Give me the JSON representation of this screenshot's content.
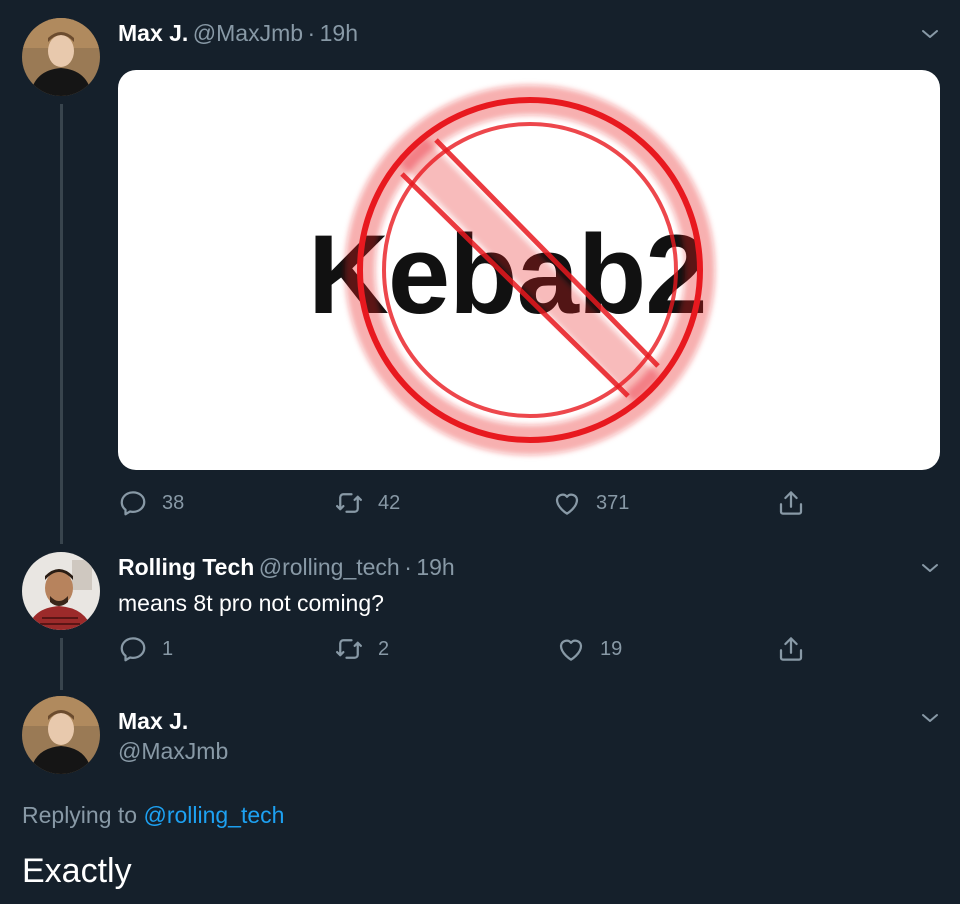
{
  "tweets": [
    {
      "name": "Max J.",
      "handle": "@MaxJmb",
      "separator": "·",
      "time": "19h",
      "media_text": "Kebab2",
      "replies": "38",
      "retweets": "42",
      "likes": "371"
    },
    {
      "name": "Rolling Tech",
      "handle": "@rolling_tech",
      "separator": "·",
      "time": "19h",
      "text": "means 8t pro not coming?",
      "replies": "1",
      "retweets": "2",
      "likes": "19"
    }
  ],
  "focused": {
    "name": "Max J.",
    "handle": "@MaxJmb",
    "replying_prefix": "Replying to",
    "replying_handle": "@rolling_tech",
    "text": "Exactly"
  },
  "colors": {
    "background": "#15202b",
    "secondary_text": "#8899a6",
    "link": "#1da1f2",
    "prohibition_red": "#e8191f"
  },
  "icons": [
    "reply-icon",
    "retweet-icon",
    "like-icon",
    "share-icon",
    "chevron-down-icon",
    "prohibition-sign-icon"
  ]
}
